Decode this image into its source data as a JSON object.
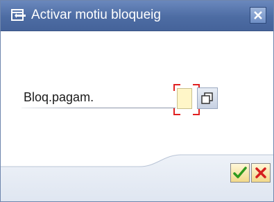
{
  "dialog": {
    "title": "Activar motiu bloqueig",
    "title_icon": "dialog-popup-icon",
    "close_icon": "close-icon"
  },
  "form": {
    "field_label": "Bloq.pagam.",
    "field_value": "",
    "help_icon": "value-help-icon"
  },
  "actions": {
    "confirm_icon": "checkmark-icon",
    "cancel_icon": "cancel-x-icon"
  },
  "colors": {
    "titlebar": "#4d6ca3",
    "input_background": "#fff6c8",
    "focus_marker": "#e02020",
    "confirm_green": "#2f9a1e",
    "cancel_red": "#d51f1f"
  }
}
